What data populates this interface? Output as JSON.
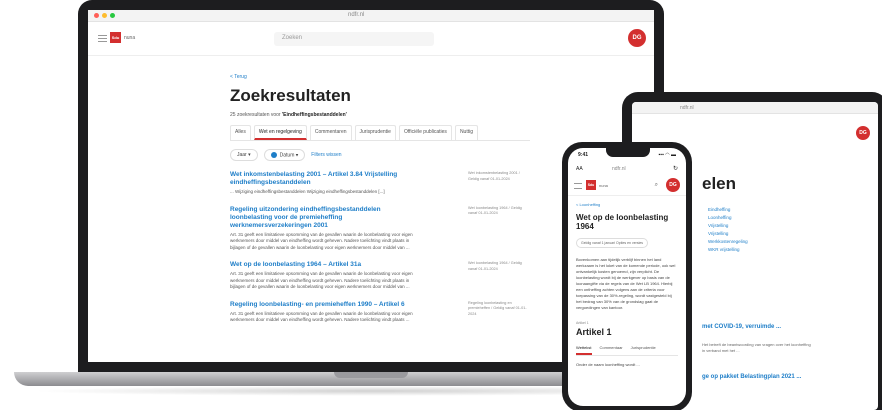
{
  "laptop": {
    "browser": {
      "url": "ndfr.nl"
    },
    "header": {
      "logo": "Sdu",
      "logo_text": "nuna",
      "search_placeholder": "Zoeken",
      "avatar": "DG"
    },
    "back_link": "< Terug",
    "page_title": "Zoekresultaten",
    "result_count_prefix": "25 zoekresultaten voor",
    "result_count_query": "'Eindheffingsbestanddelen'",
    "tabs": [
      "Alles",
      "Wet en regelgeving",
      "Commentaren",
      "Jurisprudentie",
      "Officiële publicaties",
      "Nuttig"
    ],
    "filters": {
      "year": "Jaar",
      "date": "Datum",
      "reset": "Filters wissen"
    },
    "results": [
      {
        "title": "Wet inkomstenbelasting 2001 – Artikel 3.84 Vrijstelling eindheffingsbestanddelen",
        "snippet": "... Wijziging eindheffingsbestanddelen Wijziging eindheffingsbestanddelen [...]",
        "meta": "Wet inkomstenbelasting 2001 / Geldig vanaf 01-01-2024"
      },
      {
        "title": "Regeling uitzondering eindheffingsbestanddelen loonbelasting voor de premieheffing werknemersverzekeringen 2001",
        "snippet": "Art. 31 geeft een limitatieve opsomming van de gevallen waarin de loonbelasting voor eigen werknemers door middel van eindheffing wordt geheven. Nadere toelichting vindt plaats in bijlagen of de gevallen waarin de loonbelasting voor eigen werknemers door middel van ...",
        "meta": "Wet loonbelasting 1964 / Geldig vanaf 01-01-2024"
      },
      {
        "title": "Wet op de loonbelasting 1964 – Artikel 31a",
        "snippet": "Art. 31 geeft een limitatieve opsomming van de gevallen waarin de loonbelasting voor eigen werknemers door middel van eindheffing wordt geheven. Nadere toelichting vindt plaats in bijlagen of de gevallen waarin de loonbelasting voor eigen werknemers door middel van ...",
        "meta": "Wet loonbelasting 1964 / Geldig vanaf 01-01-2024"
      },
      {
        "title": "Regeling loonbelasting- en premieheffen 1990 – Artikel 6",
        "snippet": "Art. 31 geeft een limitatieve opsomming van de gevallen waarin de loonbelasting voor eigen werknemers door middel van eindheffing wordt geheven. Nadere toelichting vindt plaats ...",
        "meta": "Regeling loonbelasting en premieheffen / Geldig vanaf 01-01-2024"
      }
    ]
  },
  "tablet": {
    "url": "ndfr.nl",
    "avatar": "DG",
    "title_fragment": "elen",
    "links": [
      "Eindheffing",
      "Loonheffing",
      "Vrijstelling",
      "Vrijstelling",
      "Werkkostenregeling",
      "WKR vrijstelling"
    ],
    "result1": "met COVID-19, verruimde ...",
    "snippet": "Het betreft de beantwoording van vragen over het loonheffing in verband met het ...",
    "result2": "ge op pakket Belastingplan 2021 ..."
  },
  "phone": {
    "time": "9:41",
    "signal": "▪▪▪ ◠ ▬",
    "browser_aa": "AA",
    "url": "ndfr.nl",
    "reload": "↻",
    "logo": "Sdu",
    "logo_text": "nuna",
    "search_icon": "⌕",
    "avatar": "DG",
    "back_link": "< Loonheffing",
    "title": "Wet op de loonbelasting 1964",
    "pill": "Geldig vanaf 1 januari Opties en versies",
    "body": "Bovenkomen aan tijdelijk verblijf binnen het land werkzaam is het loket van de komende periode, ook wel ontvankelijk kosten genoemd, zijn verplicht. De loonbelasting wordt bij de werkgever op basis van de loonaangifte via de regels van de Wet LB 1964. Hierbij een ontheffing achten volgens aan de criteria voor toepassing van de 30%-regeling, wordt vastgesteld bij het bedrag van 30% van de grondslag gaat de vergoedingen van kantoor.",
    "article_label": "Artikel 1",
    "article": "Artikel 1",
    "tabs": [
      "Wettekst",
      "Commentaar",
      "Jurisprudentie"
    ],
    "bottom": "Onder de naam loonheffing wordt ..."
  }
}
